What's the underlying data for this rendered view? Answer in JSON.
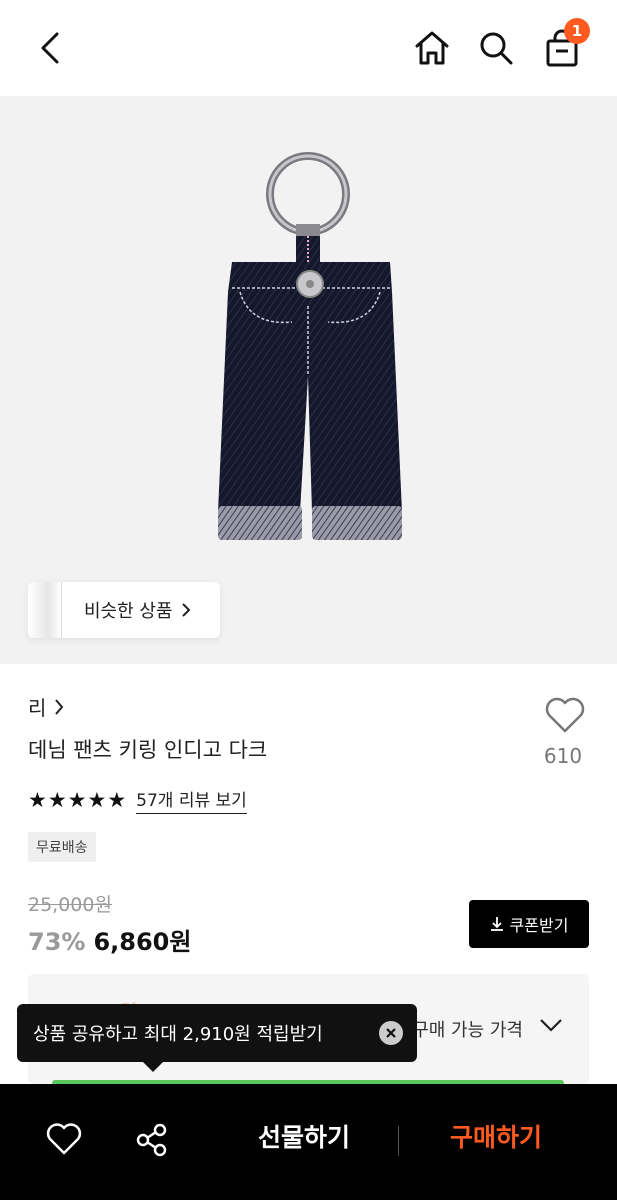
{
  "header": {
    "cart_count": "1"
  },
  "gallery": {
    "similar_label": "비슷한 상품"
  },
  "product": {
    "brand": "리",
    "title": "데님 팬츠 키링 인디고 다크",
    "likes": "610",
    "rating_stars": 5,
    "review_link": "57개 리뷰 보기",
    "shipping_badge": "무료배송",
    "original_price": "25,000원",
    "discount": "73%",
    "sale_price": "6,860원",
    "coupon_label": "쿠폰받기",
    "benefit_label": "구매 가능 가격",
    "benefit_price_obscured": "6,860원"
  },
  "tooltip": {
    "text": "상품 공유하고 최대 2,910원 적립받기"
  },
  "bottom_bar": {
    "gift_label": "선물하기",
    "buy_label": "구매하기"
  },
  "colors": {
    "accent": "#ff5a1f",
    "background_image": "#f2f2f2",
    "bottom_bar": "#000000",
    "green_bar": "#5cc85c"
  },
  "icons": [
    "back-arrow-icon",
    "home-icon",
    "search-icon",
    "shopping-bag-icon",
    "chevron-right-icon",
    "heart-outline-icon",
    "star-icon",
    "download-icon",
    "chevron-down-icon",
    "close-circle-icon",
    "share-icon"
  ]
}
